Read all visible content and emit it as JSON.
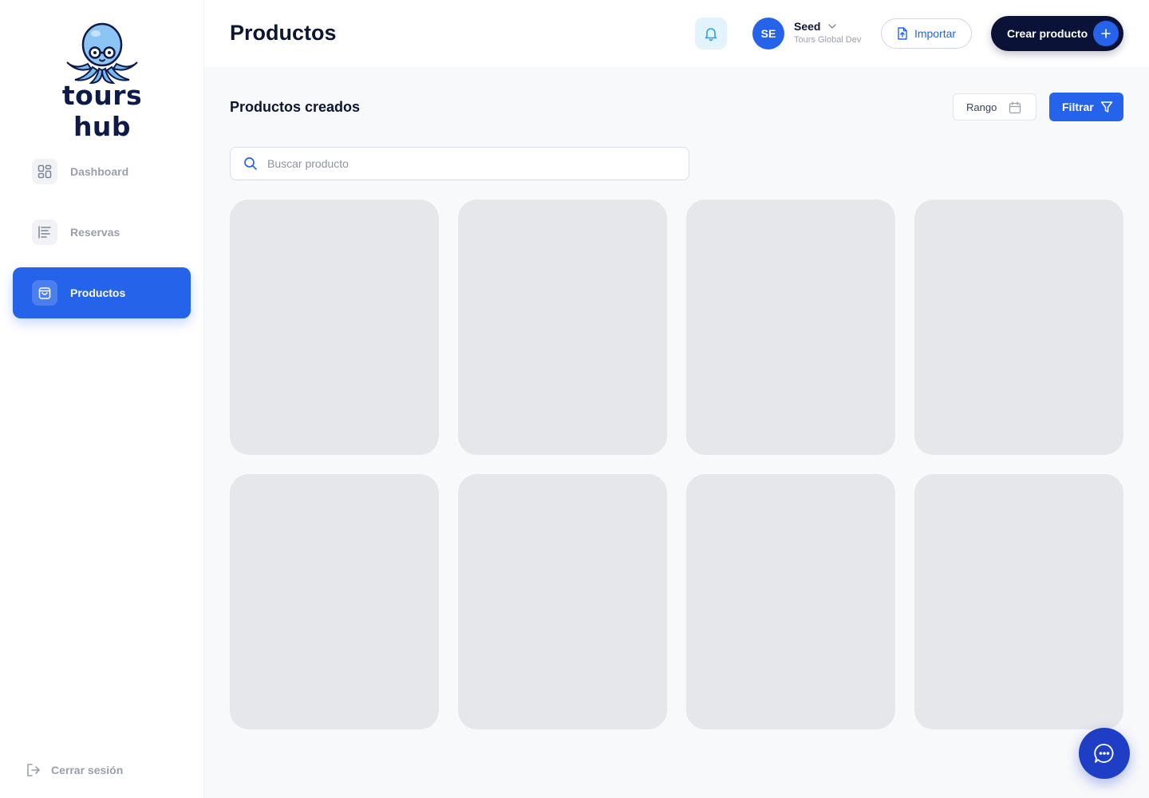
{
  "brand": {
    "name": "tours hub",
    "primary_color": "#2563eb",
    "dark_color": "#0b1238"
  },
  "sidebar": {
    "items": [
      {
        "label": "Dashboard",
        "icon": "dashboard-grid-icon",
        "active": false
      },
      {
        "label": "Reservas",
        "icon": "list-icon",
        "active": false
      },
      {
        "label": "Productos",
        "icon": "shopping-bag-icon",
        "active": true
      }
    ],
    "logout_label": "Cerrar sesión"
  },
  "header": {
    "title": "Productos",
    "user": {
      "initials": "SE",
      "name": "Seed",
      "org": "Tours Global Dev"
    },
    "import_label": "Importar",
    "create_label": "Crear producto"
  },
  "main": {
    "section_title": "Productos creados",
    "range_label": "Rango",
    "filter_label": "Filtrar",
    "search_placeholder": "Buscar producto",
    "cards": [
      {},
      {},
      {},
      {},
      {},
      {},
      {},
      {}
    ]
  }
}
